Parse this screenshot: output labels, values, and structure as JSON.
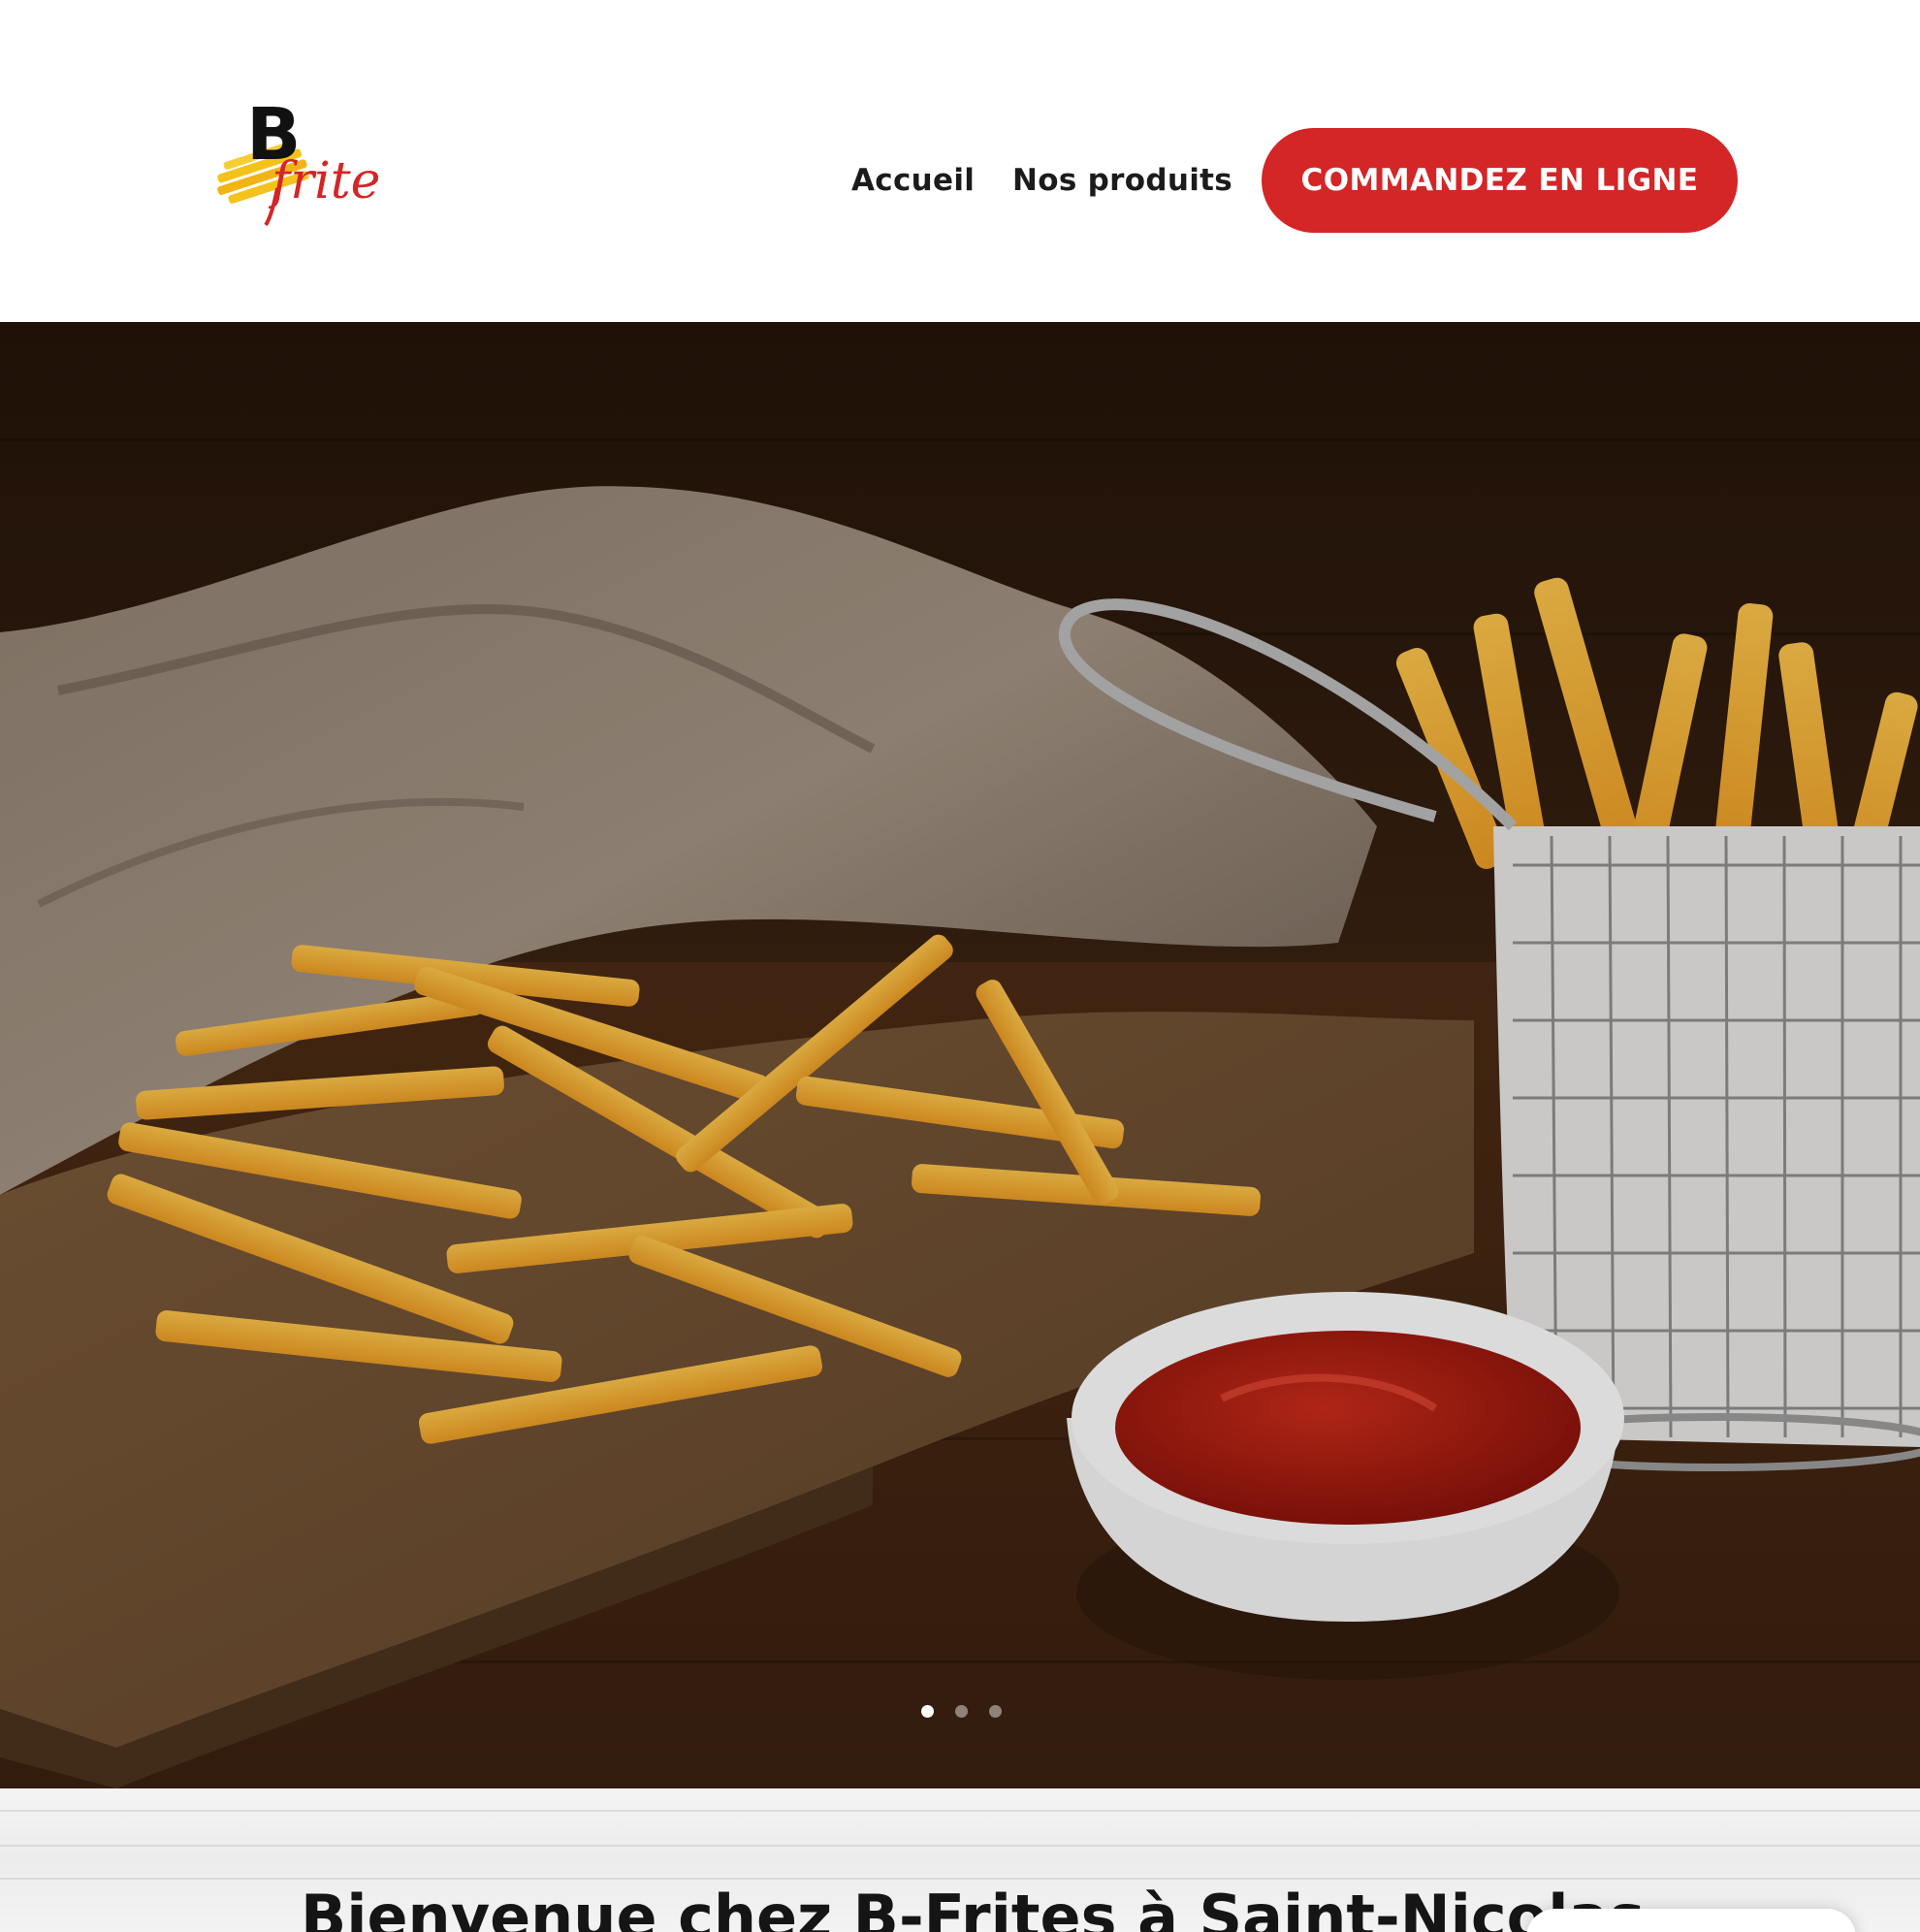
{
  "header": {
    "logo": {
      "brand_letter": "B",
      "brand_script": "frite",
      "brand_color": "#d42527"
    },
    "nav": [
      {
        "label": "Accueil"
      },
      {
        "label": "Nos produits"
      }
    ],
    "cta": {
      "label": "COMMANDEZ EN LIGNE",
      "color": "#d42527"
    }
  },
  "hero": {
    "slider": {
      "slide_count": 3,
      "active_index": 0
    },
    "image_description_icon": "fries-ketchup-photo"
  },
  "welcome": {
    "title": "Bienvenue chez B-Frites à Saint-Nicolas"
  }
}
